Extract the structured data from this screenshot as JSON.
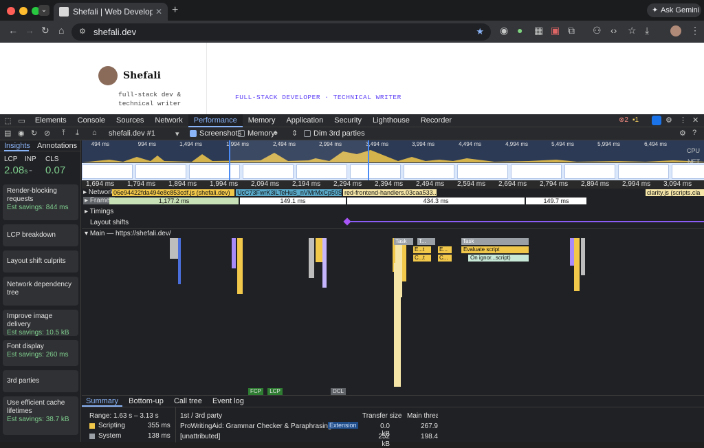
{
  "browser": {
    "tab_title": "Shefali | Web Developer ~ She",
    "url": "shefali.dev",
    "ask_gemini": "Ask Gemini"
  },
  "page": {
    "name": "Shefali",
    "tagline_1": "full-stack dev &",
    "tagline_2": "technical writer",
    "banner": "FULL-STACK DEVELOPER · TECHNICAL WRITER"
  },
  "devtools": {
    "tabs": [
      "Elements",
      "Console",
      "Sources",
      "Network",
      "Performance",
      "Memory",
      "Application",
      "Security",
      "Lighthouse",
      "Recorder"
    ],
    "active_tab": "Performance",
    "errors": "2",
    "warnings": "1",
    "recording": "shefali.dev #1",
    "screenshots_label": "Screenshots",
    "memory_label": "Memory",
    "dim_label": "Dim 3rd parties"
  },
  "sidebar": {
    "tabs": [
      "Insights",
      "Annotations"
    ],
    "metrics": [
      {
        "label": "LCP",
        "value": "2.08",
        "suffix": "s"
      },
      {
        "label": "INP",
        "value": "-"
      },
      {
        "label": "CLS",
        "value": "0.07"
      }
    ],
    "insights": [
      {
        "title": "Render-blocking requests",
        "savings": "Est savings: 844 ms"
      },
      {
        "title": "LCP breakdown",
        "savings": ""
      },
      {
        "title": "Layout shift culprits",
        "savings": ""
      },
      {
        "title": "Network dependency tree",
        "savings": ""
      },
      {
        "title": "Improve image delivery",
        "savings": "Est savings: 10.5 kB"
      },
      {
        "title": "Font display",
        "savings": "Est savings: 260 ms"
      },
      {
        "title": "3rd parties",
        "savings": ""
      },
      {
        "title": "Use efficient cache lifetimes",
        "savings": "Est savings: 38.7 kB"
      }
    ]
  },
  "overview_ticks": [
    "494 ms",
    "994 ms",
    "1,494 ms",
    "1,994 ms",
    "2,494 ms",
    "2,994 ms",
    "3,494 ms",
    "3,994 ms",
    "4,494 ms",
    "4,994 ms",
    "5,494 ms",
    "5,994 ms",
    "6,494 ms"
  ],
  "overview_labels": {
    "cpu": "CPU",
    "net": "NET"
  },
  "ruler_ticks": [
    "1,694 ms",
    "1,794 ms",
    "1,894 ms",
    "1,994 ms",
    "2,094 ms",
    "2,194 ms",
    "2,294 ms",
    "2,394 ms",
    "2,494 ms",
    "2,594 ms",
    "2,694 ms",
    "2,794 ms",
    "2,894 ms",
    "2,994 ms",
    "3,094 ms"
  ],
  "tracks": {
    "network": "Network",
    "network_items": [
      "06e94422fda494e8c853cdf.js (shefali.dev)",
      "UcC73FwrK3iLTeHuS_nVMrMxCp50SiI...",
      "red-frontend-handlers.03caa533...",
      "clarity.js (scripts.cla"
    ],
    "frames": "Frames",
    "frame_times": [
      "1,177.2 ms",
      "149.1 ms",
      "434.3 ms",
      "149.7 ms"
    ],
    "timings": "Timings",
    "layout_shifts": "Layout shifts",
    "main": "Main — https://shefali.dev/",
    "task_labels": [
      "Task",
      "T...",
      "Task"
    ],
    "eval_labels": [
      "E...t",
      "E...",
      "Evaluate script"
    ],
    "call_labels": [
      "C...t",
      "C...",
      "On ignor...script)"
    ],
    "markers": [
      "FCP",
      "LCP",
      "DCL"
    ]
  },
  "bottom": {
    "tabs": [
      "Summary",
      "Bottom-up",
      "Call tree",
      "Event log"
    ],
    "range": "Range: 1.63 s – 3.13 s",
    "legend": [
      {
        "name": "Scripting",
        "value": "355 ms",
        "color": "#f2c84b"
      },
      {
        "name": "System",
        "value": "138 ms",
        "color": "#9aa0a6"
      }
    ],
    "table_headers": [
      "1st / 3rd party",
      "Transfer size",
      "Main thread"
    ],
    "rows": [
      {
        "name": "ProWritingAid: Grammar Checker & Paraphrasing Tool",
        "badge": "Extension",
        "size": "0.0 kB",
        "main": "267.9"
      },
      {
        "name": "[unattributed]",
        "badge": "",
        "size": "252 kB",
        "main": "198.4"
      }
    ]
  }
}
